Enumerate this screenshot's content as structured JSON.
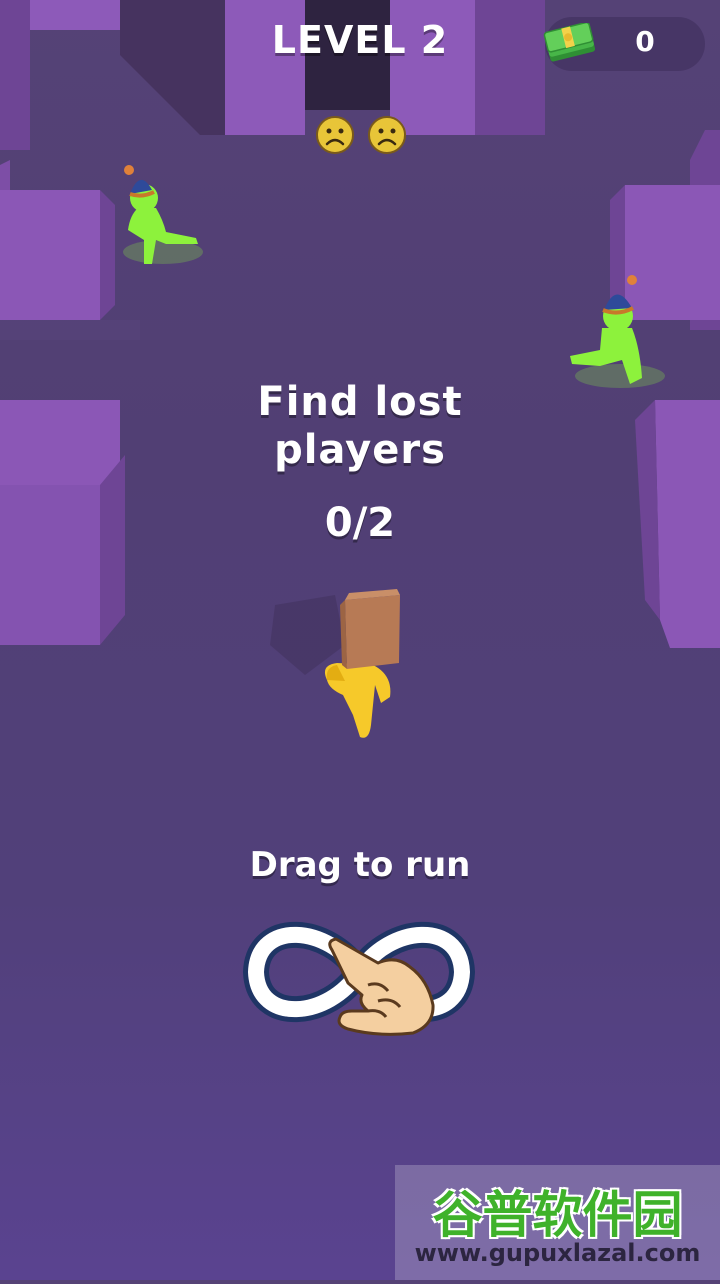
{
  "hud": {
    "level_label": "LEVEL 2",
    "cash_value": "0",
    "cash_icon": "cash-stack-icon",
    "lives": [
      {
        "icon": "sad-face-icon"
      },
      {
        "icon": "sad-face-icon"
      }
    ]
  },
  "objective": {
    "line1": "Find lost",
    "line2": "players",
    "count": "0/2",
    "found": 0,
    "total": 2
  },
  "tutorial": {
    "hint": "Drag to run",
    "gesture_icon": "infinity-drag-gesture-icon"
  },
  "watermark": {
    "title": "谷普软件园",
    "url": "www.gupuxlazal.com"
  },
  "colors": {
    "floor": "#51407a",
    "wall": "#8a58b8",
    "lost_player": "#8df23c",
    "player": "#f6c92a",
    "box": "#b77a55"
  }
}
